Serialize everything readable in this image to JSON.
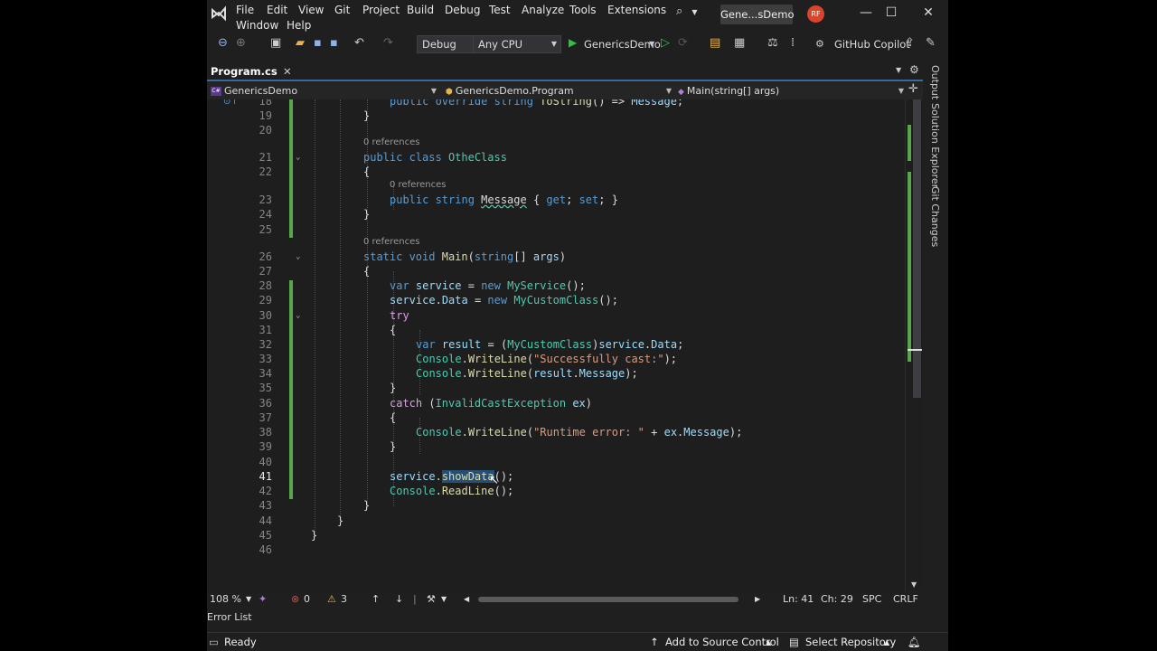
{
  "menu": {
    "items": [
      "File",
      "Edit",
      "View",
      "Git",
      "Project",
      "Build",
      "Debug",
      "Test",
      "Analyze",
      "Tools",
      "Extensions",
      "Window",
      "Help"
    ],
    "title": "Gene...sDemo",
    "avatar": "RF"
  },
  "toolbar": {
    "config": "Debug",
    "platform": "Any CPU",
    "start_target": "GenericsDemo",
    "copilot": "GitHub Copilot"
  },
  "tab": {
    "label": "Program.cs"
  },
  "navbar": {
    "project": "GenericsDemo",
    "class": "GenericsDemo.Program",
    "member": "Main(string[] args)"
  },
  "editor": {
    "current_line": 41,
    "codelens": "0 references"
  },
  "side_tabs": [
    "Output",
    "Solution Explorer",
    "Git Changes"
  ],
  "editor_status": {
    "zoom": "108 %",
    "errors": "0",
    "warnings": "3",
    "line": "Ln: 41",
    "col": "Ch: 29",
    "spc": "SPC",
    "eol": "CRLF"
  },
  "error_list": "Error List",
  "status": {
    "ready": "Ready",
    "source_control": "Add to Source Control",
    "repository": "Select Repository"
  },
  "colors": {
    "accent": "#3b6aa0",
    "change_bar": "#57a64a",
    "keyword": "#569cd6",
    "type": "#4ec9b0",
    "string": "#d69d85",
    "method": "#dcdcaa"
  }
}
